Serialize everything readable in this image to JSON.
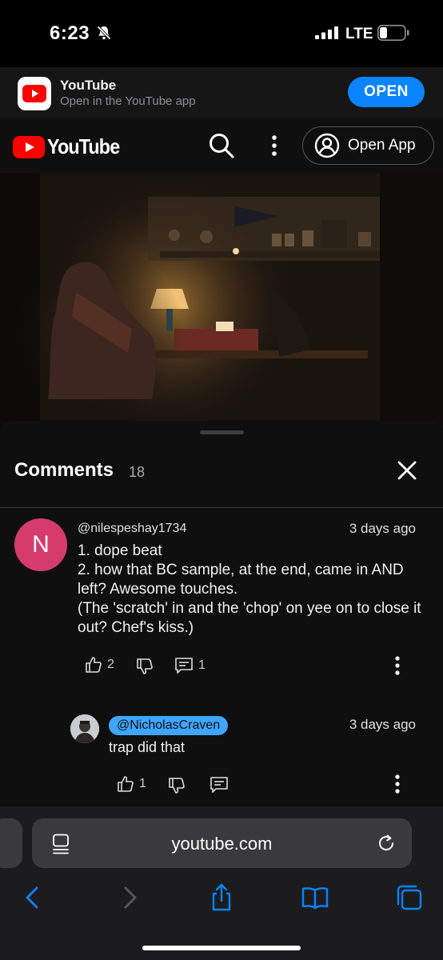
{
  "status": {
    "time": "6:23",
    "network": "LTE"
  },
  "banner": {
    "app_name": "YouTube",
    "subtitle": "Open in the YouTube app",
    "open_label": "OPEN"
  },
  "header": {
    "logo_text": "YouTube",
    "open_app_label": "Open App"
  },
  "comments": {
    "title": "Comments",
    "count": "18",
    "items": [
      {
        "avatar_letter": "N",
        "author": "@nilespeshay1734",
        "time": "3 days ago",
        "text": "1. dope beat\n2. how that BC sample, at the end, came in AND left?  Awesome touches.\n(The 'scratch' in and the 'chop' on yee on to close it out? Chef's kiss.)",
        "likes": "2",
        "replies": "1"
      },
      {
        "author": "@NicholasCraven",
        "time": "3 days ago",
        "text": "trap did that",
        "likes": "1"
      }
    ]
  },
  "safari": {
    "url": "youtube.com"
  },
  "colors": {
    "accent": "#0a84ff",
    "youtube_red": "#ff0000",
    "creator_badge": "#3ea6ff",
    "avatar_pink": "#d63b6e"
  },
  "icons": [
    "bell-slash-icon",
    "signal-icon",
    "battery-icon",
    "search-icon",
    "more-icon",
    "account-icon",
    "close-icon",
    "thumbs-up-icon",
    "thumbs-down-icon",
    "reply-icon",
    "page-icon",
    "reload-icon",
    "back-icon",
    "forward-icon",
    "share-icon",
    "bookmarks-icon",
    "tabs-icon"
  ]
}
